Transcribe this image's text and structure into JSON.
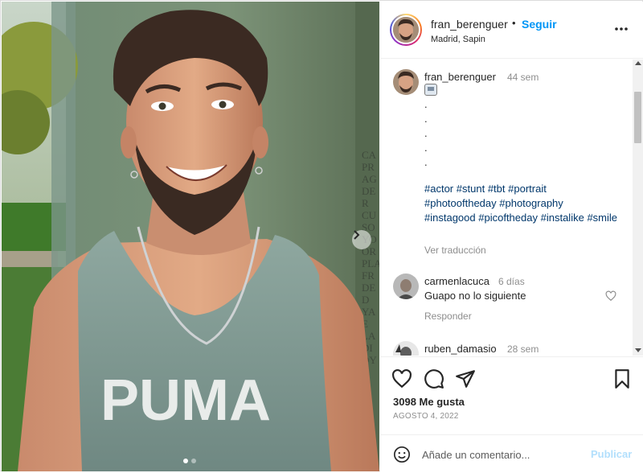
{
  "header": {
    "username": "fran_berenguer",
    "separator": "•",
    "follow_label": "Seguir",
    "location": "Madrid, Sapin",
    "more_icon": "more-horizontal-icon"
  },
  "media": {
    "next_icon": "chevron-right-icon",
    "carousel_total": 2,
    "carousel_active": 1,
    "shirt_text": "PUMA",
    "plaque_text": [
      "CA",
      "PR",
      "AG",
      "DE",
      "R",
      "CU",
      "SO",
      "YO",
      "OR",
      "PLA",
      "FR",
      "DE",
      "D",
      "YA",
      "E",
      "LA",
      "DI",
      "OY"
    ]
  },
  "caption": {
    "username": "fran_berenguer",
    "time": "44 sem",
    "emoji_icon": "framed-picture-emoji",
    "dots": [
      ".",
      ".",
      ".",
      ".",
      "."
    ],
    "hashtags": [
      "#actor",
      "#stunt",
      "#tbt",
      "#portrait",
      "#photooftheday",
      "#photography",
      "#instagood",
      "#picoftheday",
      "#instalike",
      "#smile"
    ],
    "translate_label": "Ver traducción"
  },
  "comments": [
    {
      "username": "carmenlacuca",
      "time": "6 días",
      "text": "Guapo no lo siguiente",
      "reply_label": "Responder"
    },
    {
      "username": "ruben_damasio",
      "time": "28 sem"
    }
  ],
  "actions": {
    "like_icon": "heart-icon",
    "comment_icon": "comment-icon",
    "share_icon": "send-icon",
    "save_icon": "bookmark-icon",
    "likes_text": "3098 Me gusta",
    "date_text": "AGOSTO 4, 2022"
  },
  "add_comment": {
    "emoji_icon": "smiley-icon",
    "placeholder": "Añade un comentario...",
    "publish_label": "Publicar"
  },
  "colors": {
    "link": "#0095f6",
    "hashtag": "#00376b",
    "muted": "#8e8e8e",
    "publish_disabled": "#b2dffc"
  }
}
